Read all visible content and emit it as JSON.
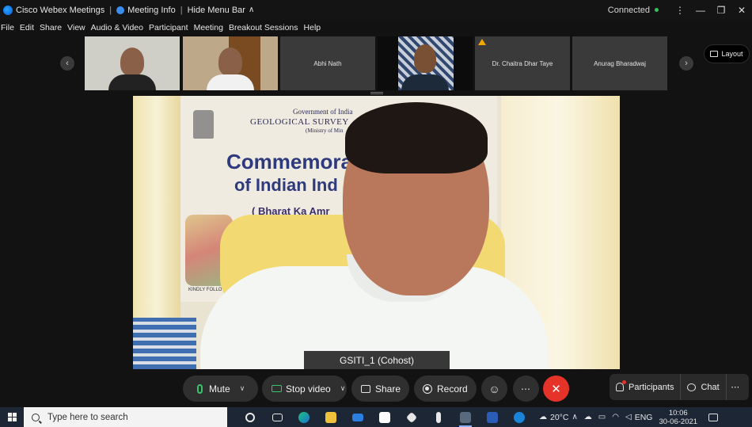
{
  "titlebar": {
    "app_title": "Cisco Webex Meetings",
    "meeting_info": "Meeting Info",
    "hide_menu_bar": "Hide Menu Bar",
    "status": "Connected",
    "status_color": "#32c45a"
  },
  "menu": {
    "items": [
      "File",
      "Edit",
      "Share",
      "View",
      "Audio & Video",
      "Participant",
      "Meeting",
      "Breakout Sessions",
      "Help"
    ]
  },
  "thumbnails": {
    "participants": [
      {
        "name": "",
        "has_video": true
      },
      {
        "name": "",
        "has_video": true
      },
      {
        "name": "Abhi Nath",
        "has_video": false
      },
      {
        "name": "",
        "has_video": true
      },
      {
        "name": "Dr. Chaitra Dhar Taye",
        "has_video": false,
        "warning": true
      },
      {
        "name": "Anurag Bharadwaj",
        "has_video": false
      }
    ],
    "layout_label": "Layout"
  },
  "main_video": {
    "speaker_label": "GSITI_1 (Cohost)",
    "banner_lines": [
      "Government of India",
      "GEOLOGICAL SURVEY",
      "(Ministry of Min",
      "Commemorati",
      "of Indian Ind",
      "( Bharat Ka Amr",
      "KINDLY FOLLOW C"
    ]
  },
  "controls": {
    "mute": "Mute",
    "stop_video": "Stop video",
    "share": "Share",
    "record": "Record",
    "participants": "Participants",
    "chat": "Chat",
    "leave_color": "#e5332a",
    "accent_color": "#39c36a"
  },
  "taskbar": {
    "search_placeholder": "Type here to search",
    "temperature": "20°C",
    "language": "ENG",
    "time": "10:06",
    "date": "30-06-2021"
  }
}
